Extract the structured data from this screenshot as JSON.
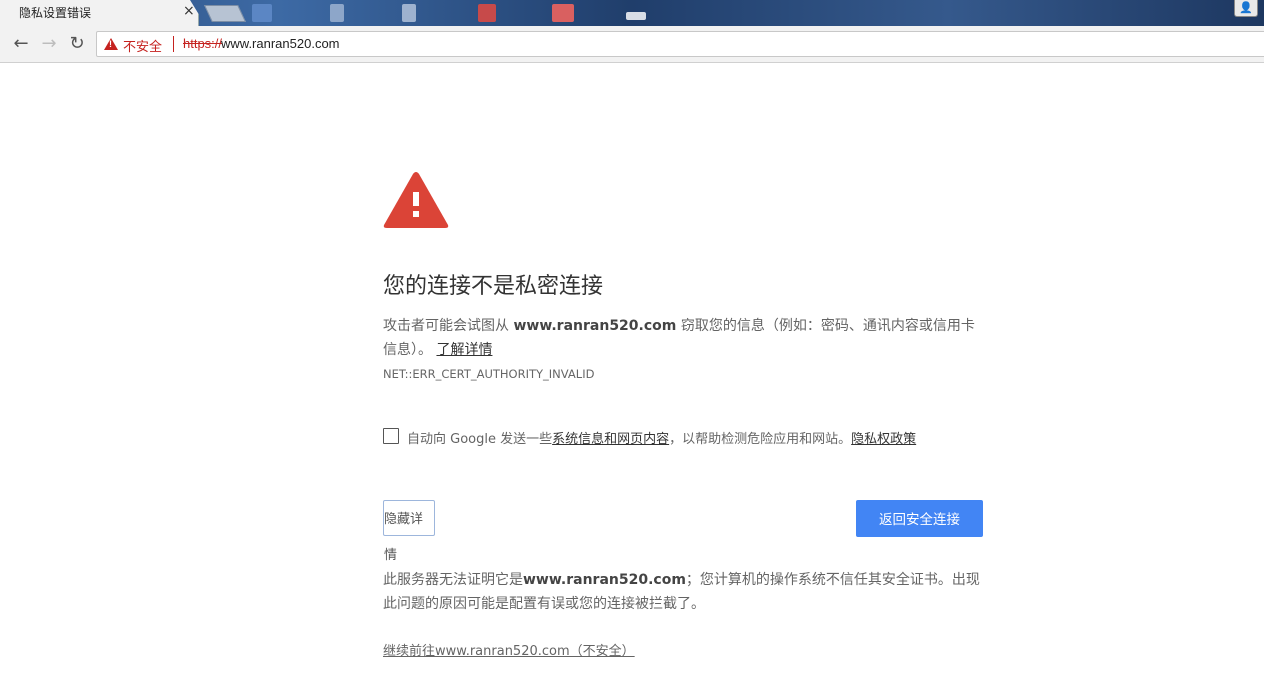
{
  "tab": {
    "title": "隐私设置错误",
    "close": "×"
  },
  "profile": {
    "glyph": "👤"
  },
  "toolbar": {
    "back_glyph": "←",
    "forward_glyph": "→",
    "reload_glyph": "↻",
    "security_label": "不安全",
    "url_scheme": "https://",
    "url_host": "www.ranran520.com"
  },
  "interstitial": {
    "icon": "warning-triangle-icon",
    "heading": "您的连接不是私密连接",
    "explanation_pre": "攻击者可能会试图从 ",
    "explanation_host": "www.ranran520.com",
    "explanation_post": " 窃取您的信息（例如：密码、通讯内容或信用卡信息）。",
    "learn_more": "了解详情",
    "error_code": "NET::ERR_CERT_AUTHORITY_INVALID",
    "extended_reporting": {
      "checked": false,
      "pre": "自动向 Google 发送一些",
      "link": "系统信息和网页内容",
      "post": "，以帮助检测危险应用和网站。",
      "privacy_link": "隐私权政策"
    },
    "details_button": "隐藏详情",
    "primary_button": "返回安全连接",
    "details_pre": "此服务器无法证明它是",
    "details_host": "www.ranran520.com",
    "details_post": "；您计算机的操作系统不信任其安全证书。出现此问题的原因可能是配置有误或您的连接被拦截了。",
    "proceed_link": "继续前往www.ranran520.com（不安全）"
  },
  "colors": {
    "danger": "#c5221f",
    "primary": "#4285f4",
    "warning_icon": "#db4437"
  }
}
